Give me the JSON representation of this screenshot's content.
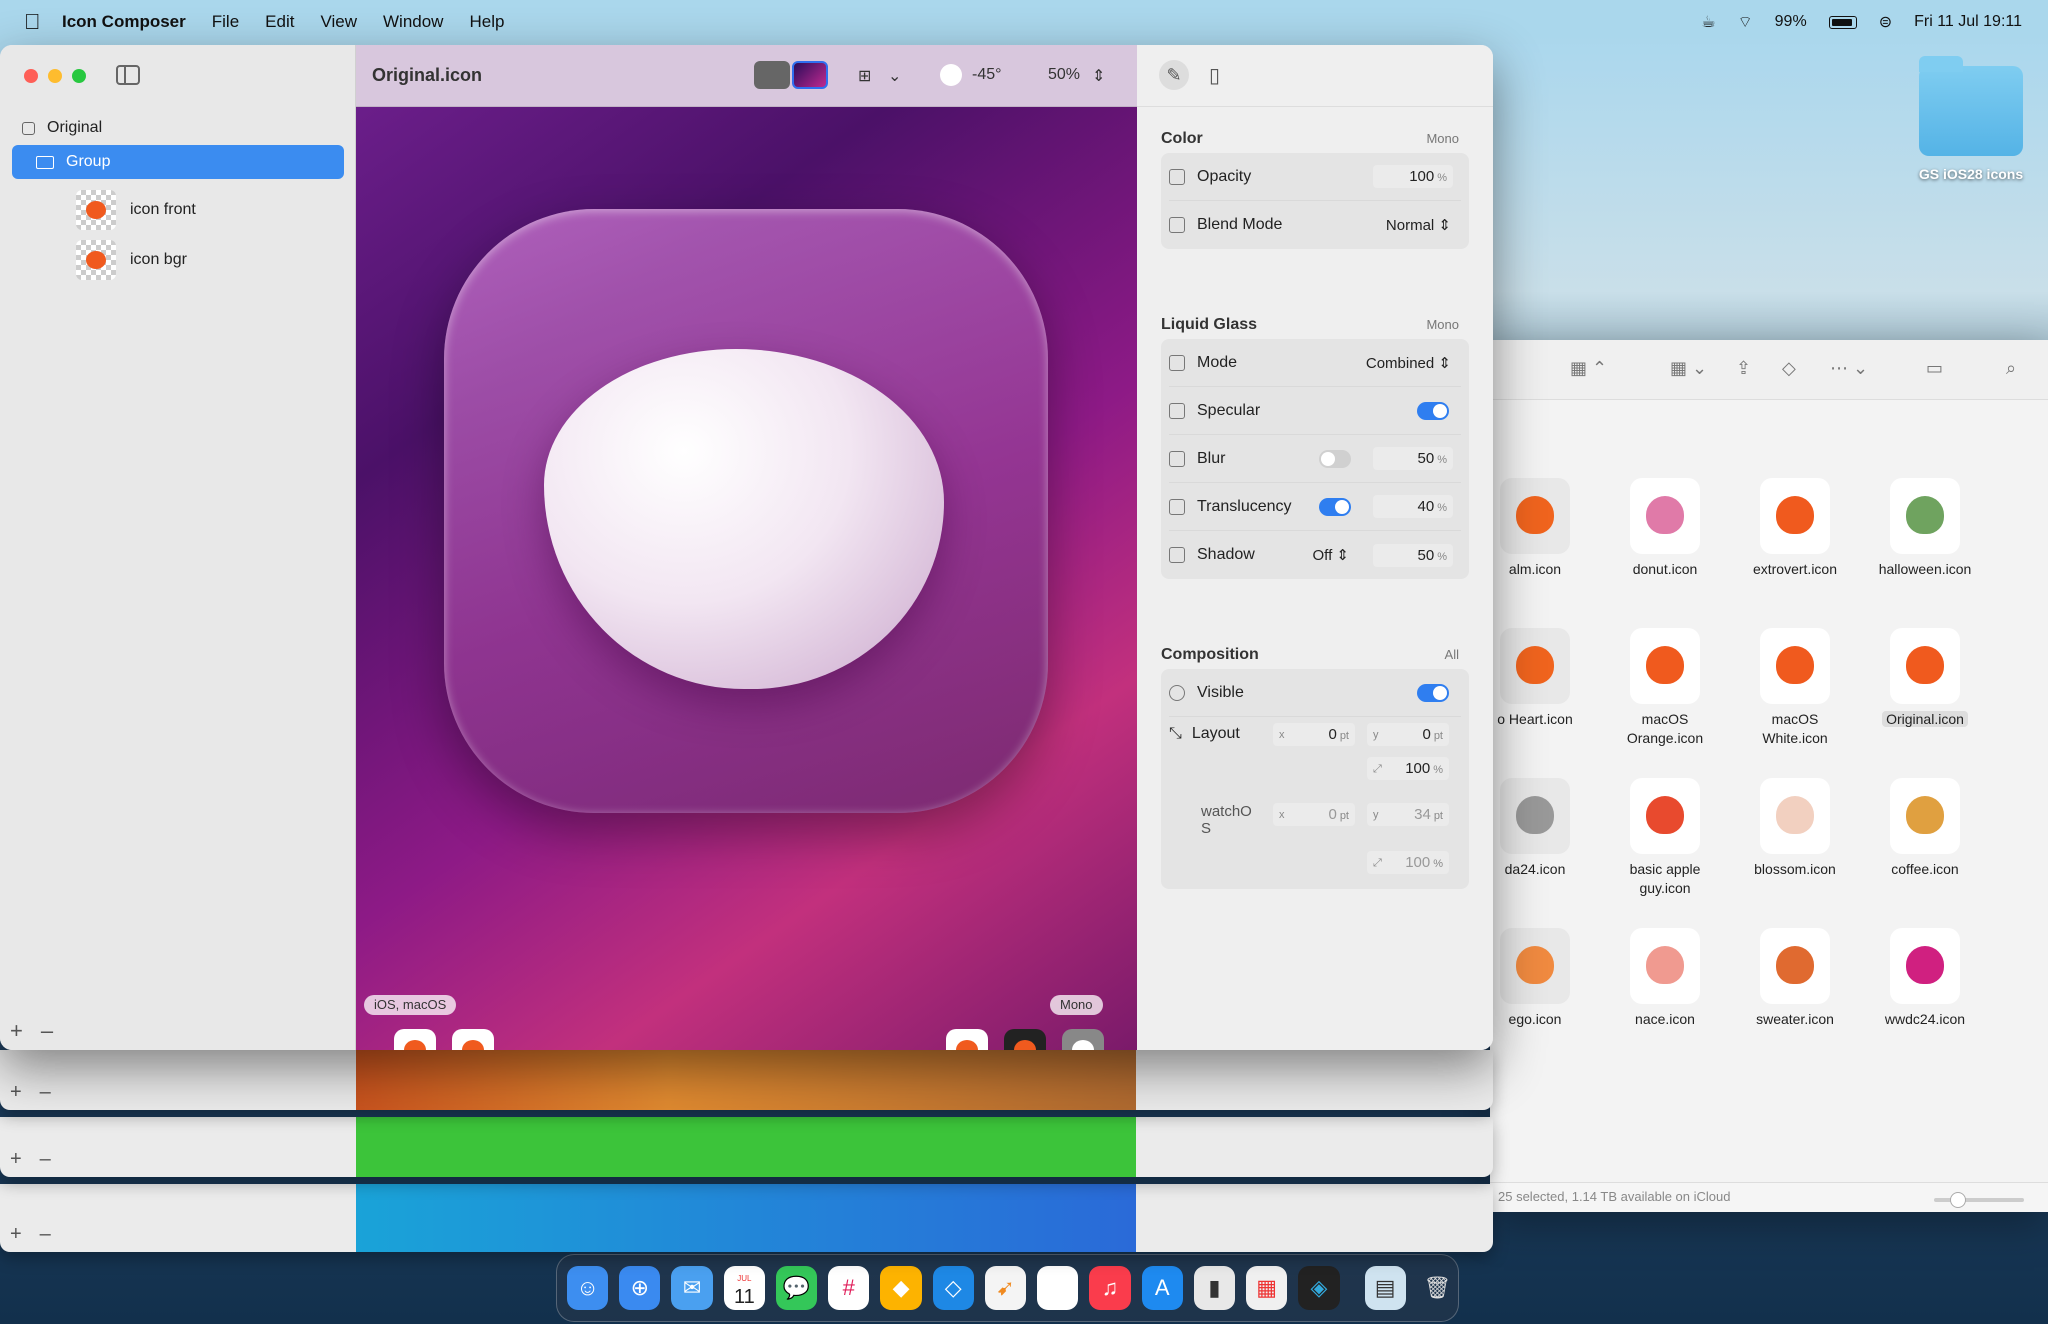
{
  "menubar": {
    "app": "Icon Composer",
    "items": [
      "File",
      "Edit",
      "View",
      "Window",
      "Help"
    ],
    "battery": "99%",
    "datetime": "Fri 11 Jul  19:11"
  },
  "desktop": {
    "folder": "GS iOS28 icons"
  },
  "sidebar": {
    "root": "Original",
    "group": "Group",
    "layers": [
      "icon front",
      "icon bgr"
    ]
  },
  "canvas": {
    "title": "Original.icon",
    "angle": "-45°",
    "zoom": "50%",
    "pill_left": "iOS, macOS",
    "pill_right": "Mono"
  },
  "inspector": {
    "color": {
      "title": "Color",
      "mode": "Mono",
      "opacity_label": "Opacity",
      "opacity": "100",
      "blend_label": "Blend Mode",
      "blend": "Normal"
    },
    "glass": {
      "title": "Liquid Glass",
      "mode": "Mono",
      "mode_label": "Mode",
      "mode_val": "Combined",
      "specular": "Specular",
      "blur": "Blur",
      "blur_val": "50",
      "trans": "Translucency",
      "trans_val": "40",
      "shadow": "Shadow",
      "shadow_mode": "Off",
      "shadow_val": "50"
    },
    "comp": {
      "title": "Composition",
      "scope": "All",
      "visible": "Visible",
      "layout": "Layout",
      "x": "0",
      "y": "0",
      "scale": "100",
      "watch": "watchO\nS",
      "wx": "0",
      "wy": "34",
      "wscale": "100"
    }
  },
  "finder": {
    "icons": [
      {
        "name": "alm.icon",
        "color": "#f0641e"
      },
      {
        "name": "donut.icon",
        "color": "#e07aa8"
      },
      {
        "name": "extrovert.icon",
        "color": "#f05a1e"
      },
      {
        "name": "halloween.icon",
        "color": "#6fa35f"
      },
      {
        "name": "o Heart.icon",
        "color": "#f0641e"
      },
      {
        "name": "macOS\nOrange.icon",
        "color": "#f05a1e"
      },
      {
        "name": "macOS\nWhite.icon",
        "color": "#f05a1e"
      },
      {
        "name": "Original.icon",
        "color": "#f05a1e"
      },
      {
        "name": "da24.icon",
        "color": "#999"
      },
      {
        "name": "basic apple\nguy.icon",
        "color": "#e84a2e"
      },
      {
        "name": "blossom.icon",
        "color": "#f2d0c0"
      },
      {
        "name": "coffee.icon",
        "color": "#e0a040"
      },
      {
        "name": "ego.icon",
        "color": "#f08a40"
      },
      {
        "name": "nace.icon",
        "color": "#f09a90"
      },
      {
        "name": "sweater.icon",
        "color": "#e06a30"
      },
      {
        "name": "wwdc24.icon",
        "color": "#d02080"
      }
    ],
    "status": "25 selected, 1.14 TB available on iCloud"
  },
  "dock": {
    "calendar_day": "11",
    "calendar_month": "JUL"
  }
}
